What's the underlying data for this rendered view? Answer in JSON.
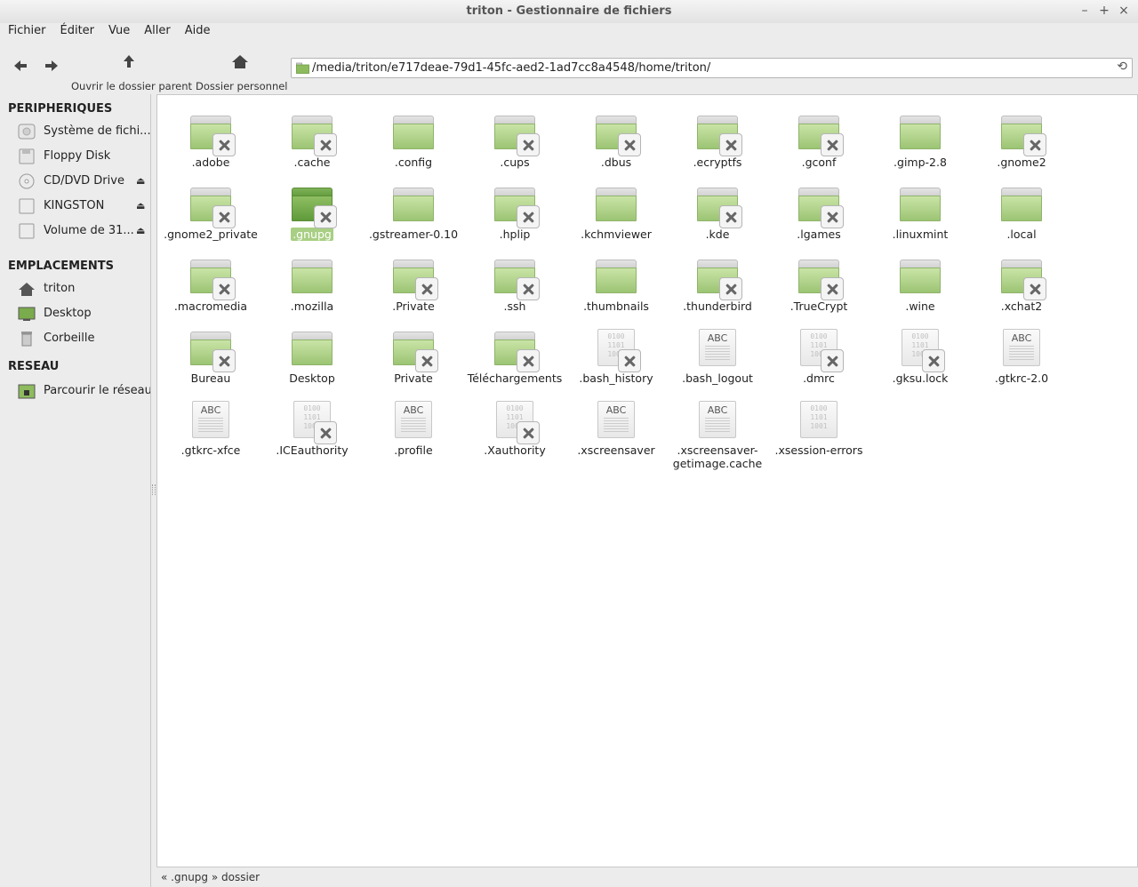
{
  "window": {
    "title": "triton - Gestionnaire de fichiers",
    "controls": [
      "–",
      "+",
      "×"
    ]
  },
  "menu": [
    "Fichier",
    "Éditer",
    "Vue",
    "Aller",
    "Aide"
  ],
  "toolbar": {
    "back_icon": "arrow-left-icon",
    "forward_icon": "arrow-right-icon",
    "parent_label": "Ouvrir le dossier parent",
    "home_label": "Dossier personnel",
    "path": "/media/triton/e717deae-79d1-45fc-aed2-1ad7cc8a4548/home/triton/"
  },
  "sidebar": {
    "devices_header": "PERIPHERIQUES",
    "devices": [
      {
        "label": "Système de fichi...",
        "icon": "harddisk-icon",
        "eject": false
      },
      {
        "label": "Floppy Disk",
        "icon": "floppy-icon",
        "eject": false
      },
      {
        "label": "CD/DVD Drive",
        "icon": "cdrom-icon",
        "eject": true
      },
      {
        "label": "KINGSTON",
        "icon": "usb-drive-icon",
        "eject": true
      },
      {
        "label": "Volume de 31...",
        "icon": "drive-icon",
        "eject": true
      }
    ],
    "places_header": "EMPLACEMENTS",
    "places": [
      {
        "label": "triton",
        "icon": "home-icon"
      },
      {
        "label": "Desktop",
        "icon": "desktop-icon"
      },
      {
        "label": "Corbeille",
        "icon": "trash-icon"
      }
    ],
    "network_header": "RESEAU",
    "network": [
      {
        "label": "Parcourir le réseau",
        "icon": "network-icon"
      }
    ]
  },
  "files": [
    {
      "name": ".adobe",
      "type": "folder",
      "locked": true
    },
    {
      "name": ".cache",
      "type": "folder",
      "locked": true
    },
    {
      "name": ".config",
      "type": "folder",
      "locked": false
    },
    {
      "name": ".cups",
      "type": "folder",
      "locked": true
    },
    {
      "name": ".dbus",
      "type": "folder",
      "locked": true
    },
    {
      "name": ".ecryptfs",
      "type": "folder",
      "locked": true
    },
    {
      "name": ".gconf",
      "type": "folder",
      "locked": true
    },
    {
      "name": ".gimp-2.8",
      "type": "folder",
      "locked": false
    },
    {
      "name": ".gnome2",
      "type": "folder",
      "locked": true
    },
    {
      "name": ".gnome2_private",
      "type": "folder",
      "locked": true
    },
    {
      "name": ".gnupg",
      "type": "folder",
      "locked": true,
      "selected": true
    },
    {
      "name": ".gstreamer-0.10",
      "type": "folder",
      "locked": false
    },
    {
      "name": ".hplip",
      "type": "folder",
      "locked": true
    },
    {
      "name": ".kchmviewer",
      "type": "folder",
      "locked": false
    },
    {
      "name": ".kde",
      "type": "folder",
      "locked": true
    },
    {
      "name": ".lgames",
      "type": "folder",
      "locked": true
    },
    {
      "name": ".linuxmint",
      "type": "folder",
      "locked": false
    },
    {
      "name": ".local",
      "type": "folder",
      "locked": false
    },
    {
      "name": ".macromedia",
      "type": "folder",
      "locked": true
    },
    {
      "name": ".mozilla",
      "type": "folder",
      "locked": false
    },
    {
      "name": ".Private",
      "type": "folder",
      "locked": true
    },
    {
      "name": ".ssh",
      "type": "folder",
      "locked": true
    },
    {
      "name": ".thumbnails",
      "type": "folder",
      "locked": false
    },
    {
      "name": ".thunderbird",
      "type": "folder",
      "locked": true
    },
    {
      "name": ".TrueCrypt",
      "type": "folder",
      "locked": true
    },
    {
      "name": ".wine",
      "type": "folder",
      "locked": false
    },
    {
      "name": ".xchat2",
      "type": "folder",
      "locked": true
    },
    {
      "name": "Bureau",
      "type": "folder",
      "locked": true
    },
    {
      "name": "Desktop",
      "type": "folder",
      "locked": false
    },
    {
      "name": "Private",
      "type": "folder",
      "locked": true
    },
    {
      "name": "Téléchargements",
      "type": "folder",
      "locked": true
    },
    {
      "name": ".bash_history",
      "type": "binary",
      "locked": true
    },
    {
      "name": ".bash_logout",
      "type": "text",
      "locked": false
    },
    {
      "name": ".dmrc",
      "type": "binary",
      "locked": true
    },
    {
      "name": ".gksu.lock",
      "type": "binary",
      "locked": true
    },
    {
      "name": ".gtkrc-2.0",
      "type": "text",
      "locked": false
    },
    {
      "name": ".gtkrc-xfce",
      "type": "text",
      "locked": false
    },
    {
      "name": ".ICEauthority",
      "type": "binary",
      "locked": true
    },
    {
      "name": ".profile",
      "type": "text",
      "locked": false
    },
    {
      "name": ".Xauthority",
      "type": "binary",
      "locked": true
    },
    {
      "name": ".xscreensaver",
      "type": "text",
      "locked": false
    },
    {
      "name": ".xscreensaver-getimage.cache",
      "type": "text",
      "locked": false
    },
    {
      "name": ".xsession-errors",
      "type": "binary",
      "locked": false
    }
  ],
  "text_icon_label": "ABC",
  "binary_icon_label": "0100\n1101\n1001",
  "status": "« .gnupg » dossier"
}
